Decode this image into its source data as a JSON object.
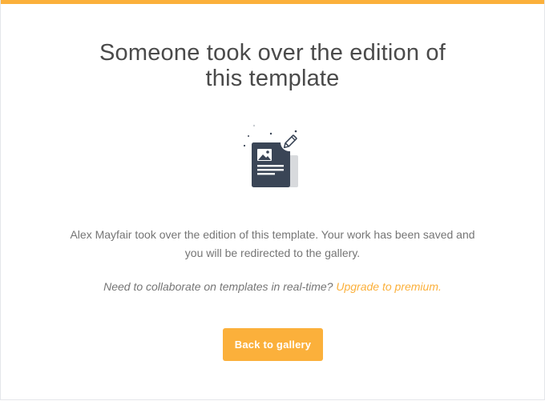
{
  "modal": {
    "title_line1": "Someone took over the edition of",
    "title_line2": "this template",
    "message_line1": "Alex Mayfair took over the edition of this template. Your work has been saved and",
    "message_line2": "you will be redirected to the gallery.",
    "upsell_text": "Need to collaborate on templates in real-time?",
    "upsell_link": "Upgrade to premium.",
    "back_button_label": "Back to gallery",
    "illustration_icon": "document-edit-icon"
  },
  "colors": {
    "accent": "#fbb03b",
    "title_text": "#4a4a4a",
    "body_text": "#757575",
    "document": "#3a4556",
    "document_shadow": "#d8dadd"
  }
}
